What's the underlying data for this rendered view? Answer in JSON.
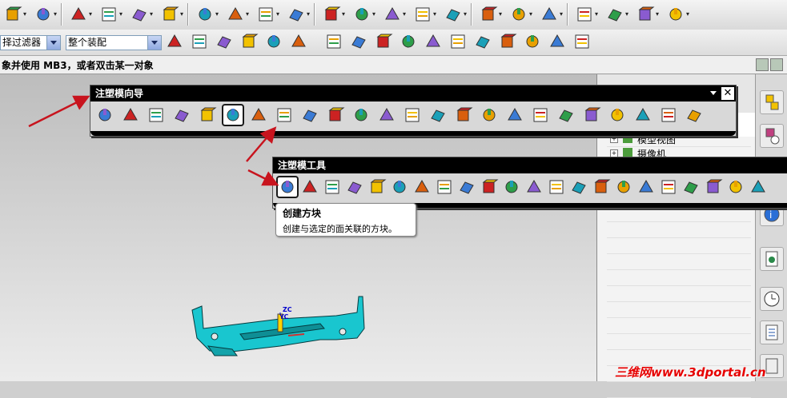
{
  "colors": {
    "accent_red": "#c8141e",
    "palette_title_bg": "#000000",
    "part_cyan": "#19c6cf"
  },
  "toolbar_top": {
    "icons": [
      "new-file-icon",
      "open-part-icon",
      "sketch-icon",
      "feature-icon",
      "block-icon",
      "extrude-icon",
      "box-icon",
      "shell-icon",
      "face-op-icon",
      "sew-icon",
      "unite-icon",
      "subtract-icon",
      "intersect-icon",
      "trim-body-icon",
      "split-body-icon",
      "solid-icon",
      "surface-icon",
      "sweep-icon",
      "mesh-surface-icon",
      "bounded-plane-icon",
      "offset-surface-icon",
      "ruled-surface-icon"
    ]
  },
  "toolbar_second": {
    "filter_combo": "择过滤器",
    "assembly_combo": "整个装配",
    "icons": [
      "assembly-cursor-icon",
      "undo-icon",
      "select-face-icon",
      "component-icon",
      "move-icon",
      "rect-select-icon",
      "snap-all-icon",
      "line-icon",
      "diagonal-line-icon",
      "curve-icon",
      "bisector-icon",
      "circle-center-icon",
      "circle-icon",
      "plus-icon",
      "slash-icon",
      "view-icon",
      "cube-icon"
    ]
  },
  "status": {
    "message": "象并使用 MB3，或者双击某一对象"
  },
  "palette_wizard": {
    "title": "注塑模向导",
    "tools": [
      "project-init-icon",
      "mold-csys-icon",
      "shrinkage-icon",
      "workpiece-icon",
      "cavity-layout-icon",
      "mold-tools-icon",
      "parting-icon",
      "moldbase-icon",
      "standard-parts-icon",
      "ejector-pin-icon",
      "ejector-post-icon",
      "slider-lifter-icon",
      "sub-insert-icon",
      "gate-icon",
      "runner-icon",
      "cooling-icon",
      "electrode-icon",
      "trim-mold-icon",
      "pocket-icon",
      "bom-icon",
      "drawing-icon",
      "view-manager-icon",
      "delete-files-icon",
      "hole-table-icon"
    ]
  },
  "palette_tools": {
    "title": "注塑模工具",
    "tools": [
      "create-box-icon",
      "split-solid-icon",
      "solid-patch-icon",
      "surface-patch-icon",
      "edge-patch-icon",
      "enlarge-surface-icon",
      "existing-surface-icon",
      "trim-region-patch-icon",
      "replace-solid-icon",
      "extend-icon",
      "reference-blend-icon",
      "auto-unblend-icon",
      "mold-draft-icon",
      "face-split-icon",
      "trim-solid-icon",
      "solid-flatten-icon",
      "pocket-tool-icon",
      "wcs-icon",
      "merge-cavity-icon",
      "design-insert-icon",
      "interference-icon",
      "extend-sheet-icon"
    ]
  },
  "tooltip": {
    "title": "创建方块",
    "description": "创建与选定的面关联的方块。"
  },
  "right_panel": {
    "tree": [
      "模型视图",
      "摄像机"
    ]
  },
  "viewport": {
    "axis_labels": [
      "ZC",
      "YC"
    ]
  },
  "watermark": "三维网www.3dportal.cn"
}
